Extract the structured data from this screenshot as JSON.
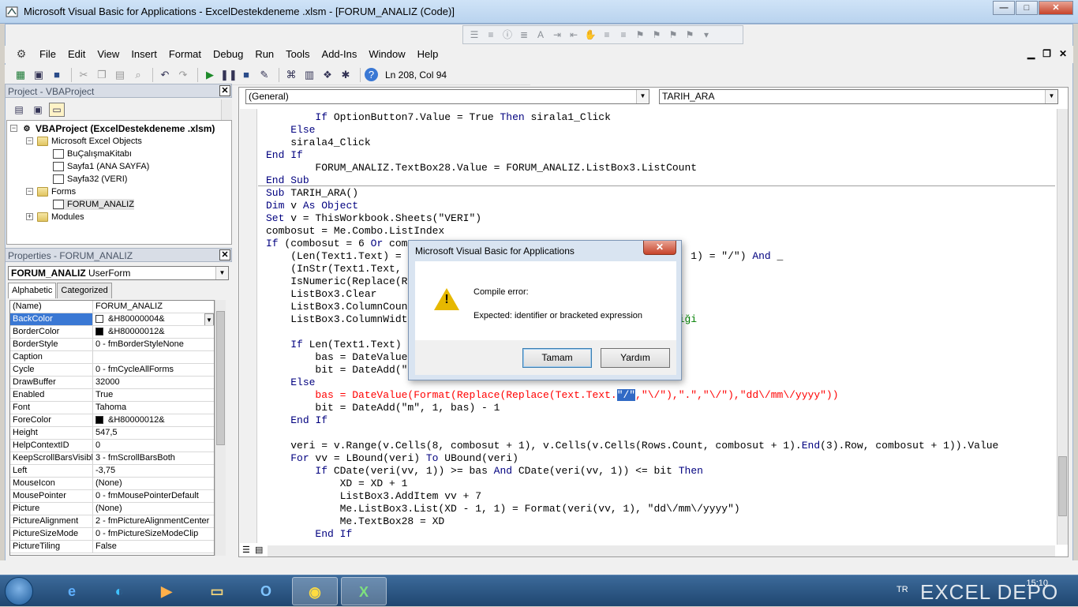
{
  "window": {
    "title": "Microsoft Visual Basic for Applications - ExcelDestekdeneme .xlsm - [FORUM_ANALIZ (Code)]"
  },
  "menu": [
    "File",
    "Edit",
    "View",
    "Insert",
    "Format",
    "Debug",
    "Run",
    "Tools",
    "Add-Ins",
    "Window",
    "Help"
  ],
  "toolbar": {
    "position": "Ln 208, Col 94"
  },
  "project": {
    "title": "Project - VBAProject",
    "root": "VBAProject (ExcelDestekdeneme .xlsm)",
    "excel_objects": "Microsoft Excel Objects",
    "items": [
      "BuÇalışmaKitabı",
      "Sayfa1 (ANA SAYFA)",
      "Sayfa32 (VERI)"
    ],
    "forms": "Forms",
    "form_item": "FORUM_ANALIZ",
    "modules": "Modules"
  },
  "properties": {
    "title": "Properties - FORUM_ANALIZ",
    "object_name": "FORUM_ANALIZ",
    "object_type": "UserForm",
    "tab_alphabetic": "Alphabetic",
    "tab_categorized": "Categorized",
    "rows": [
      {
        "name": "(Name)",
        "value": "FORUM_ANALIZ"
      },
      {
        "name": "BackColor",
        "value": "&H80000004&",
        "swatch": "#ffffff"
      },
      {
        "name": "BorderColor",
        "value": "&H80000012&",
        "swatch": "#000000"
      },
      {
        "name": "BorderStyle",
        "value": "0 - fmBorderStyleNone"
      },
      {
        "name": "Caption",
        "value": ""
      },
      {
        "name": "Cycle",
        "value": "0 - fmCycleAllForms"
      },
      {
        "name": "DrawBuffer",
        "value": "32000"
      },
      {
        "name": "Enabled",
        "value": "True"
      },
      {
        "name": "Font",
        "value": "Tahoma"
      },
      {
        "name": "ForeColor",
        "value": "&H80000012&",
        "swatch": "#000000"
      },
      {
        "name": "Height",
        "value": "547,5"
      },
      {
        "name": "HelpContextID",
        "value": "0"
      },
      {
        "name": "KeepScrollBarsVisible",
        "value": "3 - fmScrollBarsBoth"
      },
      {
        "name": "Left",
        "value": "-3,75"
      },
      {
        "name": "MouseIcon",
        "value": "(None)"
      },
      {
        "name": "MousePointer",
        "value": "0 - fmMousePointerDefault"
      },
      {
        "name": "Picture",
        "value": "(None)"
      },
      {
        "name": "PictureAlignment",
        "value": "2 - fmPictureAlignmentCenter"
      },
      {
        "name": "PictureSizeMode",
        "value": "0 - fmPictureSizeModeClip"
      },
      {
        "name": "PictureTiling",
        "value": "False"
      }
    ]
  },
  "code": {
    "object_combo": "(General)",
    "proc_combo": "TARIH_ARA",
    "lines": [
      "        If OptionButton7.Value = True Then sirala1_Click",
      "    Else",
      "    sirala4_Click",
      "End If",
      "        FORUM_ANALIZ.TextBox28.Value = FORUM_ANALIZ.ListBox3.ListCount",
      "End Sub",
      "Sub TARIH_ARA()",
      "Dim v As Object",
      "Set v = ThisWorkbook.Sheets(\"VERI\")",
      "combosut = Me.Combo.ListIndex",
      "If (combosut = 6 Or com",
      "    (Len(Text1.Text) =                                          ext, 1) = \"/\") And _",
      "    (InStr(Text1.Text,                                          _",
      "    IsNumeric(Replace(R",
      "    ListBox3.Clear",
      "    ListBox3.ColumnCoun",
      "    ListBox3.ColumnWidt                                          şliği",
      "",
      "    If Len(Text1.Text)",
      "        bas = DateValue",
      "        bit = DateAdd(\"",
      "    Else",
      "        bas = DateValue(Format(Replace(Replace(Text.Text.\"/\",\"\\/\"),\".\",\"\\/\"),\"dd\\/mm\\/yyyy\"))",
      "        bit = DateAdd(\"m\", 1, bas) - 1",
      "    End If",
      "",
      "    veri = v.Range(v.Cells(8, combosut + 1), v.Cells(v.Cells(Rows.Count, combosut + 1).End(3).Row, combosut + 1)).Value",
      "    For vv = LBound(veri) To UBound(veri)",
      "        If CDate(veri(vv, 1)) >= bas And CDate(veri(vv, 1)) <= bit Then",
      "            XD = XD + 1",
      "            ListBox3.AddItem vv + 7",
      "            Me.ListBox3.List(XD - 1, 1) = Format(veri(vv, 1), \"dd\\/mm\\/yyyy\")",
      "            Me.TextBox28 = XD",
      "        End If"
    ]
  },
  "dialog": {
    "title": "Microsoft Visual Basic for Applications",
    "message1": "Compile error:",
    "message2": "Expected: identifier or bracketed expression",
    "ok": "Tamam",
    "help": "Yardım"
  },
  "taskbar": {
    "lang": "TR",
    "clock": "15:10",
    "watermark": "EXCEL DEPO"
  }
}
